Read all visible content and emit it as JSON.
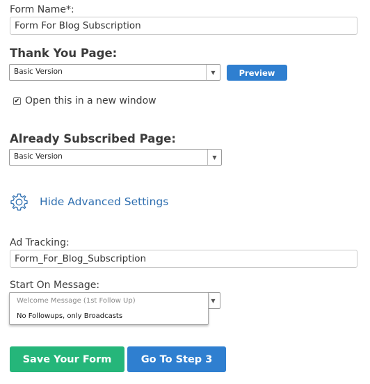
{
  "form_name": {
    "label": "Form Name*:",
    "value": "Form For Blog Subscription"
  },
  "thank_you": {
    "heading": "Thank You Page:",
    "selected": "Basic Version",
    "preview_label": "Preview",
    "checkbox_label": "Open this in a new window",
    "checkbox_checked": true
  },
  "already_subscribed": {
    "heading": "Already Subscribed Page:",
    "selected": "Basic Version"
  },
  "advanced": {
    "toggle_label": "Hide Advanced Settings",
    "icon": "gear-icon"
  },
  "ad_tracking": {
    "label": "Ad Tracking:",
    "value": "Form_For_Blog_Subscription"
  },
  "start_message": {
    "label": "Start On Message:",
    "options": [
      "Welcome Message (1st Follow Up)",
      "No Followups, only Broadcasts"
    ]
  },
  "actions": {
    "save_label": "Save Your Form",
    "step_label": "Go To Step 3"
  },
  "colors": {
    "green": "#25b67a",
    "blue": "#2f7fd0",
    "link": "#2f6fb0"
  }
}
